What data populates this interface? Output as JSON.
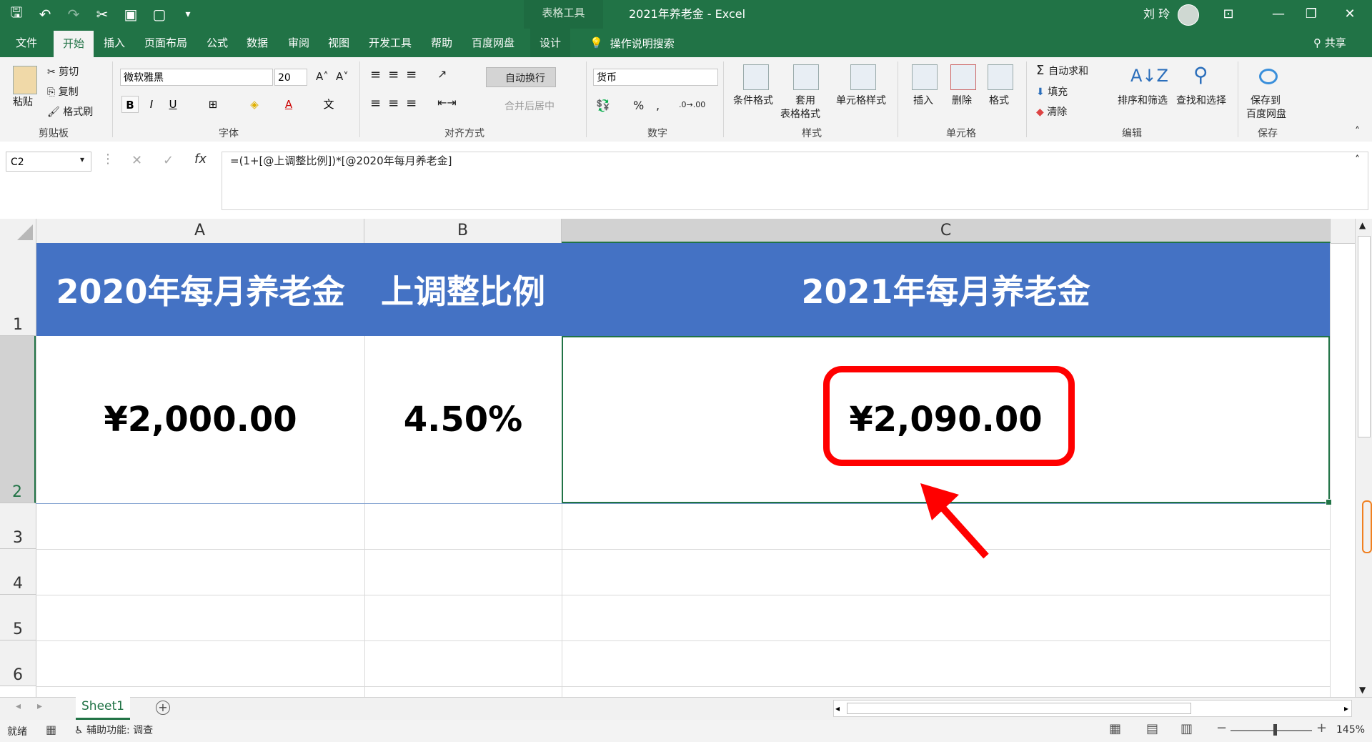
{
  "window": {
    "doc_title": "2021年养老金  -  Excel",
    "context_tab": "表格工具",
    "user_name": "刘 玲"
  },
  "tabs": [
    "文件",
    "开始",
    "插入",
    "页面布局",
    "公式",
    "数据",
    "审阅",
    "视图",
    "开发工具",
    "帮助",
    "百度网盘",
    "设计"
  ],
  "tell_me": "操作说明搜索",
  "share": "共享",
  "ribbon": {
    "clipboard": {
      "paste": "粘贴",
      "cut": "剪切",
      "copy": "复制",
      "painter": "格式刷",
      "label": "剪贴板"
    },
    "font": {
      "name": "微软雅黑",
      "size": "20",
      "label": "字体"
    },
    "alignment": {
      "wrap": "自动换行",
      "merge": "合并后居中",
      "label": "对齐方式"
    },
    "number": {
      "format": "货币",
      "label": "数字"
    },
    "styles": {
      "cond": "条件格式",
      "table1": "套用",
      "table2": "表格格式",
      "cell": "单元格样式",
      "label": "样式"
    },
    "cells": {
      "insert": "插入",
      "delete": "删除",
      "format": "格式",
      "label": "单元格"
    },
    "editing": {
      "autosum": "自动求和",
      "fill": "填充",
      "clear": "清除",
      "sort": "排序和筛选",
      "find": "查找和选择",
      "label": "编辑"
    },
    "save": {
      "line1": "保存到",
      "line2": "百度网盘",
      "label": "保存"
    }
  },
  "formula_bar": {
    "name_box": "C2",
    "fx": "fx",
    "formula": "=(1+[@上调整比例])*[@2020年每月养老金]"
  },
  "columns": [
    "A",
    "B",
    "C"
  ],
  "rows": [
    "1",
    "2",
    "3",
    "4",
    "5",
    "6"
  ],
  "table": {
    "headers": [
      "2020年每月养老金",
      "上调整比例",
      "2021年每月养老金"
    ],
    "values": [
      "¥2,000.00",
      "4.50%",
      "¥2,090.00"
    ]
  },
  "sheet_tab": "Sheet1",
  "status": {
    "ready": "就绪",
    "accessibility": "辅助功能: 调查",
    "zoom": "145%"
  },
  "colors": {
    "excel_green": "#217346",
    "header_blue": "#4472c4",
    "highlight_red": "#ff0000"
  }
}
